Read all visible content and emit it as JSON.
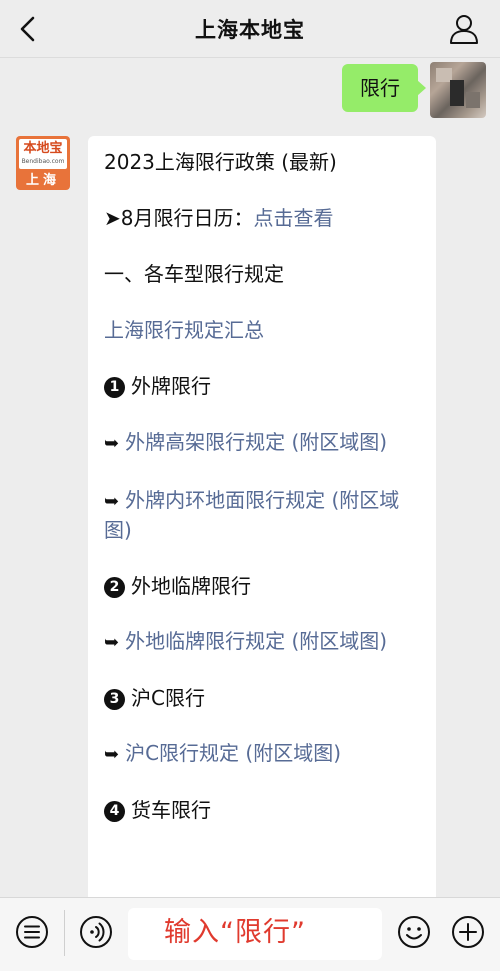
{
  "header": {
    "title": "上海本地宝"
  },
  "user_message": {
    "text": "限行"
  },
  "bot": {
    "avatar": {
      "brand": "本地宝",
      "domain": "Bendibao.com",
      "city": "上海"
    },
    "title": "2023上海限行政策 (最新)",
    "calendar_prefix": "➤8月限行日历：",
    "calendar_link": "点击查看",
    "section1": "一、各车型限行规定",
    "summary_link": "上海限行规定汇总",
    "items": [
      {
        "num": "1",
        "label": "外牌限行"
      },
      {
        "num": "2",
        "label": "外地临牌限行"
      },
      {
        "num": "3",
        "label": "沪C限行"
      },
      {
        "num": "4",
        "label": "货车限行"
      }
    ],
    "links": [
      "外牌高架限行规定 (附区域图)",
      "外牌内环地面限行规定 (附区域图)",
      "外地临牌限行规定 (附区域图)",
      "沪C限行规定 (附区域图)"
    ]
  },
  "input_bar": {
    "value": "输入“限行”"
  },
  "icons": {
    "back": "chevron-left-icon",
    "profile": "person-icon",
    "menu": "menu-list-icon",
    "voice": "voice-icon",
    "emoji": "emoji-icon",
    "plus": "plus-icon"
  },
  "colors": {
    "bubble_user": "#95ec69",
    "link": "#576b95",
    "input_text": "#e03a2e"
  }
}
